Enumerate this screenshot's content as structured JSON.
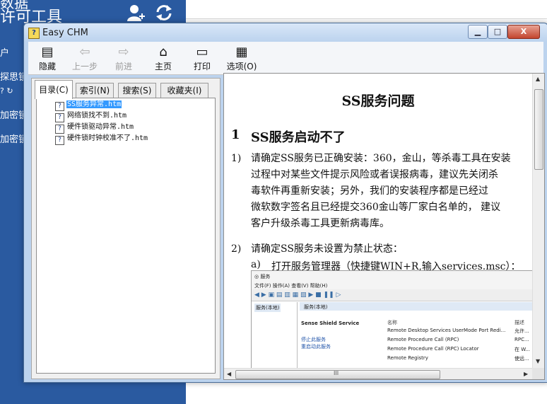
{
  "background_app": {
    "title_top": "数据",
    "title": "许可工具",
    "sidebar_items": [
      "户",
      "探思锁",
      "加密锁",
      "加密锁"
    ],
    "colors": {
      "sidebar": "#2a5aa0"
    }
  },
  "window": {
    "title": "Easy CHM",
    "controls": {
      "minimize": "▁",
      "maximize": "□",
      "close": "X"
    }
  },
  "toolbar": {
    "hide": "隐藏",
    "back": "上一步",
    "forward": "前进",
    "home": "主页",
    "print": "打印",
    "options": "选项(O)"
  },
  "nav_tabs": [
    "目录(C)",
    "索引(N)",
    "搜索(S)",
    "收藏夹(I)"
  ],
  "tree_items": [
    {
      "label": "SS服务异常.htm",
      "selected": true
    },
    {
      "label": "网络锁找不到.htm",
      "selected": false
    },
    {
      "label": "硬件锁驱动异常.htm",
      "selected": false
    },
    {
      "label": "硬件锁时钟校准不了.htm",
      "selected": false
    }
  ],
  "doc": {
    "title": "SS服务问题",
    "section_num": "1",
    "section_title": "SS服务启动不了",
    "p1_num": "1)",
    "p1_lines": [
      "请确定SS服务已正确安装：360，金山，等杀毒工具在安装",
      "过程中对某些文件提示风险或者误报病毒，建议先关闭杀",
      "毒软件再重新安装；另外，我们的安装程序都是已经过",
      "微软数字签名且已经提交360金山等厂家白名单的，  建议",
      "客户升级杀毒工具更新病毒库。"
    ],
    "p2_num": "2)",
    "p2_text": "请确定SS服务未设置为禁止状态：",
    "sub_num": "a)",
    "sub_text": "打开服务管理器（快捷键WIN+R,输入services.msc）："
  },
  "embedded_screenshot": {
    "title": "服务",
    "menu": "文件(F)   操作(A)   查看(V)   帮助(H)",
    "left_item": "服务(本地)",
    "header": "服务(本地)",
    "service_name": "Sense Shield Service",
    "links": [
      "停止此服务",
      "重启动此服务"
    ],
    "columns": [
      "名称",
      "描述"
    ],
    "rows": [
      {
        "name": "Remote Desktop Services UserMode Port Redi...",
        "desc": "允许..."
      },
      {
        "name": "Remote Procedure Call (RPC)",
        "desc": "RPC..."
      },
      {
        "name": "Remote Procedure Call (RPC) Locator",
        "desc": "在 W..."
      },
      {
        "name": "Remote Registry",
        "desc": "使远..."
      }
    ]
  },
  "scrollbar": {
    "hscroll_grip": "III"
  }
}
